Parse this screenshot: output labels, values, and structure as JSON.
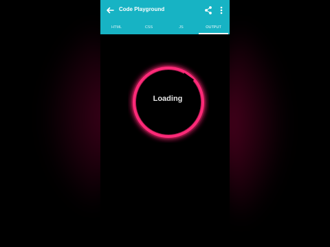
{
  "app": {
    "title": "Code Playground"
  },
  "toolbar": {
    "back_icon": "arrow-back-icon",
    "share_icon": "share-icon",
    "more_icon": "more-vert-icon"
  },
  "tabs": [
    {
      "label": "HTML",
      "active": false
    },
    {
      "label": "CSS",
      "active": false
    },
    {
      "label": "JS",
      "active": false
    },
    {
      "label": "OUTPUT",
      "active": true
    }
  ],
  "output": {
    "loading_text": "Loading"
  },
  "colors": {
    "appbar": "#17b3c4",
    "ring": "#ff1a6e",
    "background": "#000000"
  }
}
